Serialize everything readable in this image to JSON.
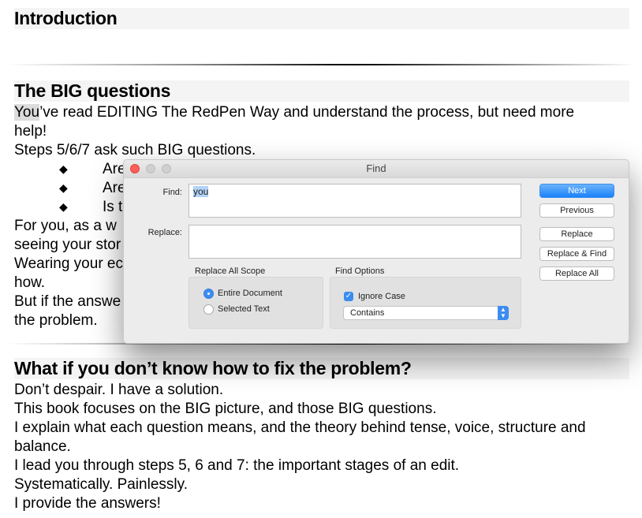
{
  "document": {
    "heading1": "Introduction",
    "heading2": "The BIG questions",
    "para1_highlight": "You",
    "para1_rest": "’ve read EDITING The RedPen Way and understand the process, but need more",
    "para1_line2": "help!",
    "para2": "Steps 5/6/7 ask such BIG questions.",
    "bullets": [
      "Are",
      "Are",
      "Is t"
    ],
    "lines_partial": [
      "For you, as a w",
      "seeing your stor",
      "Wearing your ec",
      "how.",
      "But if the answe",
      "the problem."
    ],
    "heading3": "What if you don’t know how to fix the problem?",
    "lines": [
      "Don’t despair. I have a solution.",
      "This book focuses on the BIG picture, and those BIG questions.",
      "I explain what each question means, and the theory behind tense, voice, structure and",
      "balance.",
      "I lead you through steps 5, 6 and 7: the important stages of an edit.",
      "Systematically. Painlessly.",
      "I provide the answers!"
    ]
  },
  "dialog": {
    "title": "Find",
    "find_label": "Find:",
    "find_value": "you",
    "replace_label": "Replace:",
    "replace_value": "",
    "scope_title": "Replace All Scope",
    "scope_options": [
      "Entire Document",
      "Selected Text"
    ],
    "scope_selected": "Entire Document",
    "options_title": "Find Options",
    "ignore_case_label": "Ignore Case",
    "ignore_case_checked": true,
    "match_mode": "Contains",
    "buttons": {
      "next": "Next",
      "previous": "Previous",
      "replace": "Replace",
      "replace_find": "Replace & Find",
      "replace_all": "Replace All"
    },
    "accent_color": "#3b8cf0"
  }
}
